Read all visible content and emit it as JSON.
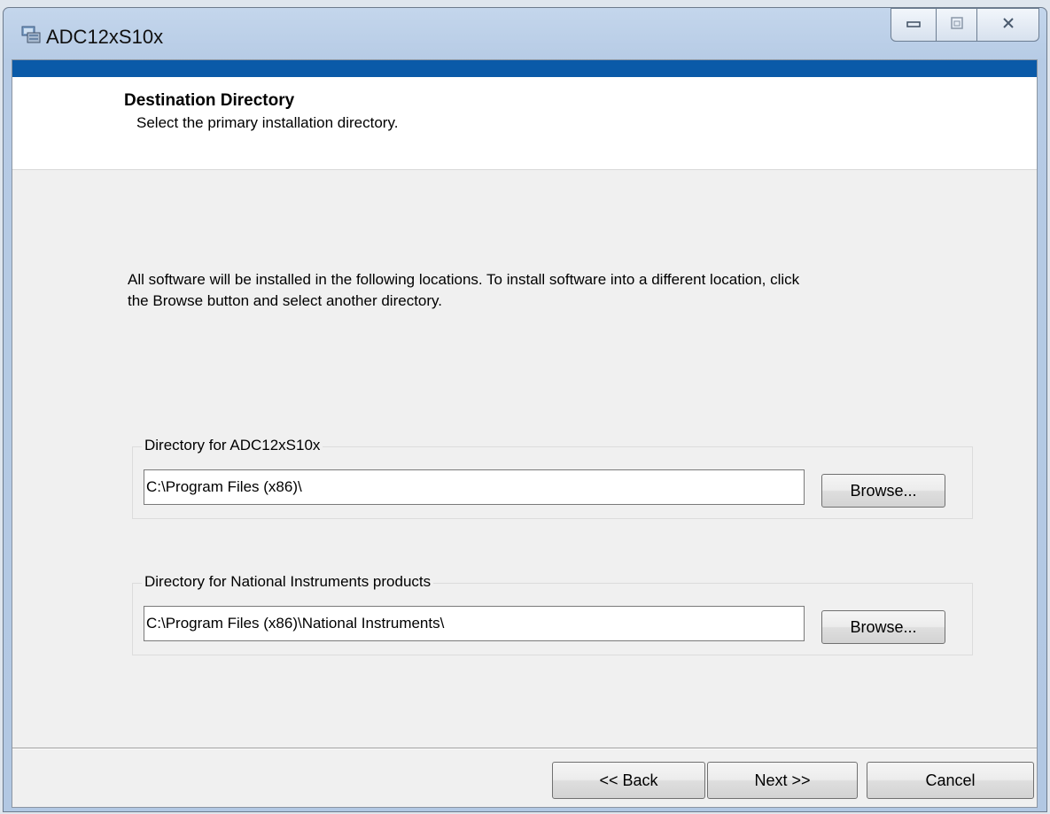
{
  "window": {
    "title": "ADC12xS10x",
    "controls": {
      "minimize": "minimize",
      "maximize": "maximize",
      "close": "close"
    }
  },
  "header": {
    "title": "Destination Directory",
    "subtitle": "Select the primary installation directory."
  },
  "description": "All software will be installed in the following locations. To install software into a different location, click the Browse button and select another directory.",
  "directories": [
    {
      "label": "Directory for ADC12xS10x",
      "path": "C:\\Program Files (x86)\\",
      "browse_label": "Browse..."
    },
    {
      "label": "Directory for National Instruments products",
      "path": "C:\\Program Files (x86)\\National Instruments\\",
      "browse_label": "Browse..."
    }
  ],
  "footer": {
    "back_label": "<< Back",
    "next_label": "Next >>",
    "cancel_label": "Cancel"
  },
  "colors": {
    "header_strip": "#0a5aa8",
    "dialog_background": "#f0f0f0",
    "title_bar": "#b6cbe5"
  }
}
